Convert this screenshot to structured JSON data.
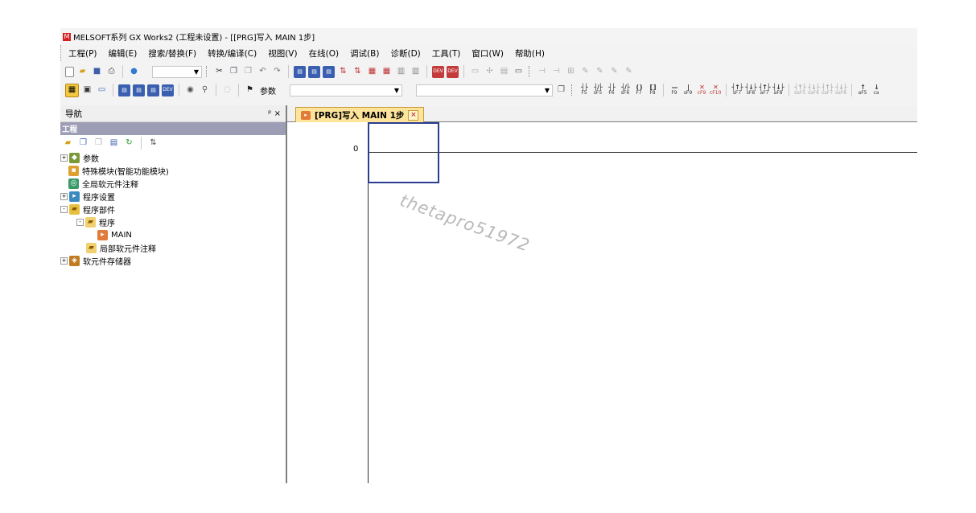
{
  "app": {
    "title": "MELSOFT系列 GX Works2 (工程未设置) - [[PRG]写入 MAIN 1步]"
  },
  "menu": [
    "工程(P)",
    "编辑(E)",
    "搜索/替换(F)",
    "转换/编译(C)",
    "视图(V)",
    "在线(O)",
    "调试(B)",
    "诊断(D)",
    "工具(T)",
    "窗口(W)",
    "帮助(H)"
  ],
  "toolbar2": {
    "combo_label": "参数"
  },
  "navigation": {
    "title": "导航",
    "pin": "ᵖ ×",
    "project_header": "工程",
    "tree": [
      {
        "label": "参数",
        "level": 0,
        "expander": "+"
      },
      {
        "label": "特殊模块(智能功能模块)",
        "level": 0,
        "expander": ""
      },
      {
        "label": "全局软元件注释",
        "level": 0,
        "expander": ""
      },
      {
        "label": "程序设置",
        "level": 0,
        "expander": "+"
      },
      {
        "label": "程序部件",
        "level": 0,
        "expander": "-"
      },
      {
        "label": "程序",
        "level": 1,
        "expander": "-"
      },
      {
        "label": "MAIN",
        "level": 2,
        "expander": ""
      },
      {
        "label": "局部软元件注释",
        "level": 1,
        "expander": ""
      },
      {
        "label": "软元件存储器",
        "level": 0,
        "expander": "+"
      }
    ]
  },
  "editor": {
    "tab_label": "[PRG]写入 MAIN 1步",
    "tab_close": "×",
    "rung_number": "0"
  },
  "watermark": "thetapro51972",
  "colors": {
    "project_header": "#9d9eb6",
    "tab_bg": "#fde49a",
    "cursor": "#2a3d8f"
  }
}
